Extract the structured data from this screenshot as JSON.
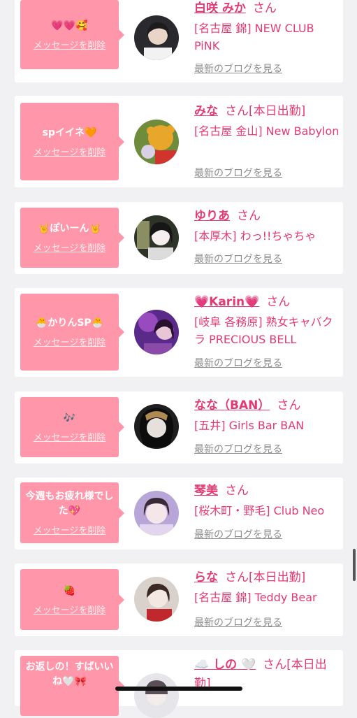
{
  "common": {
    "delete_label": "メッセージを削除",
    "blog_label": "最新のブログを見る",
    "san": "さん"
  },
  "entries": [
    {
      "message": "💗💗🥰",
      "name": "白咲 みか",
      "status": "",
      "shop": "[名古屋 錦] NEW CLUB PiNK"
    },
    {
      "message": "spイイネ🧡",
      "name": "みな",
      "status": "[本日出勤]",
      "shop": "[名古屋 金山] New Babylon"
    },
    {
      "message": "🤘ぽいーん🤘",
      "name": "ゆりあ",
      "status": "",
      "shop": "[本厚木] わっ!!ちゃちゃ"
    },
    {
      "message": "🐣かりんSP🐣",
      "name": "💗Karin💗",
      "status": "",
      "shop": "[岐阜 各務原] 熟女キャバクラ PRECIOUS BELL"
    },
    {
      "message": "🎶",
      "name": "なな（BAN）",
      "status": "",
      "shop": "[五井] Girls Bar BAN"
    },
    {
      "message": "今週もお疲れ様でした💖",
      "name": "琴美",
      "status": "",
      "shop": "[桜木町・野毛] Club Neo"
    },
    {
      "message": "🍓",
      "name": "らな",
      "status": "[本日出勤]",
      "shop": "[名古屋 錦] Teddy Bear"
    },
    {
      "message": "お返しの！すばいいね🤍🎀",
      "name": "☁️ しの 🤍",
      "status": "[本日出勤]",
      "shop": ""
    }
  ],
  "colors": {
    "accent": "#e33a73",
    "bubble": "#ff96aa",
    "background": "#f1f1f3"
  }
}
